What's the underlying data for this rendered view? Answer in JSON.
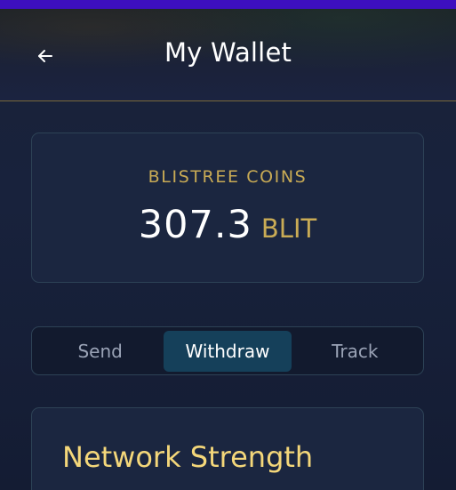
{
  "top_strip_color": "#3d0fbf",
  "header": {
    "back_icon": "arrow-left-icon",
    "title": "My Wallet"
  },
  "balance": {
    "label": "BLISTREE COINS",
    "amount": "307.3",
    "unit": "BLIT",
    "accent_color": "#c9ab55"
  },
  "tabs": {
    "items": [
      {
        "label": "Send",
        "active": false
      },
      {
        "label": "Withdraw",
        "active": true
      },
      {
        "label": "Track",
        "active": false
      }
    ],
    "active_color": "#15405a"
  },
  "network_card": {
    "title": "Network Strength",
    "title_color": "#f4d77a"
  }
}
